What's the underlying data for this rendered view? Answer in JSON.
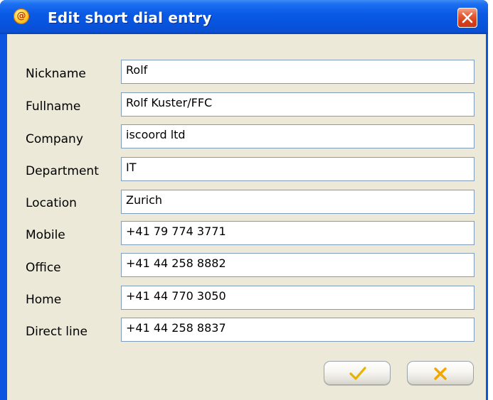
{
  "window": {
    "title": "Edit short dial entry",
    "app_icon": "at-sign-icon",
    "close_icon": "close-icon"
  },
  "form": {
    "fields": [
      {
        "label": "Nickname",
        "value": "Rolf"
      },
      {
        "label": "Fullname",
        "value": "Rolf Kuster/FFC"
      },
      {
        "label": "Company",
        "value": "iscoord ltd"
      },
      {
        "label": "Department",
        "value": "IT"
      },
      {
        "label": "Location",
        "value": "Zurich"
      },
      {
        "label": "Mobile",
        "value": "+41 79 774 3771"
      },
      {
        "label": "Office",
        "value": "+41 44 258 8882"
      },
      {
        "label": "Home",
        "value": "+41 44 770 3050"
      },
      {
        "label": "Direct line",
        "value": "+41 44 258 8837"
      }
    ]
  },
  "buttons": {
    "ok_icon": "checkmark-icon",
    "cancel_icon": "x-icon",
    "ok_color": "#e8b200",
    "cancel_color": "#f0a800"
  },
  "colors": {
    "titlebar": "#0a56e0",
    "client_background": "#ece9d8",
    "input_border": "#7f9db9",
    "close_button": "#d3401b"
  }
}
